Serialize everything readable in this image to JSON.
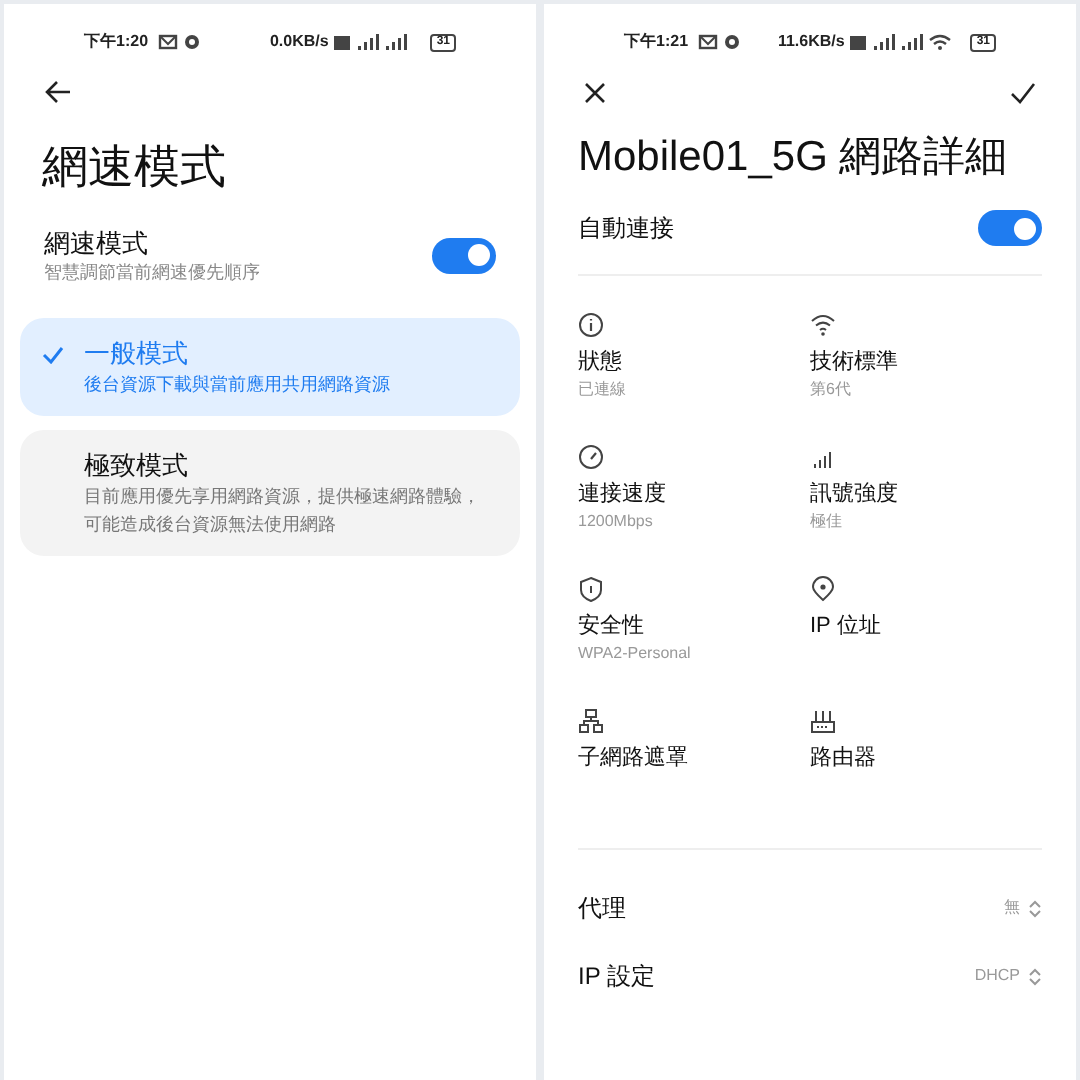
{
  "left_screen": {
    "status_bar": {
      "time": "下午1:20",
      "speed": "0.0KB/s",
      "battery": "31"
    },
    "title": "網速模式",
    "setting": {
      "label": "網速模式",
      "description": "智慧調節當前網速優先順序",
      "on": true
    },
    "modes": [
      {
        "title": "一般模式",
        "description": "後台資源下載與當前應用共用網路資源",
        "selected": true
      },
      {
        "title": "極致模式",
        "description": "目前應用優先享用網路資源，提供極速網路體驗，可能造成後台資源無法使用網路",
        "selected": false
      }
    ]
  },
  "right_screen": {
    "status_bar": {
      "time": "下午1:21",
      "speed": "11.6KB/s",
      "battery": "31"
    },
    "title": "Mobile01_5G 網路詳細",
    "auto_connect": {
      "label": "自動連接",
      "on": true
    },
    "details": [
      {
        "kind": "info",
        "label": "狀態",
        "value": "已連線"
      },
      {
        "kind": "wifi",
        "label": "技術標準",
        "value": "第6代"
      },
      {
        "kind": "speed",
        "label": "連接速度",
        "value": "1200Mbps"
      },
      {
        "kind": "signal",
        "label": "訊號強度",
        "value": "極佳"
      },
      {
        "kind": "security",
        "label": "安全性",
        "value": "WPA2-Personal"
      },
      {
        "kind": "ip",
        "label": "IP 位址"
      },
      {
        "kind": "subnet",
        "label": "子網路遮罩"
      },
      {
        "kind": "router",
        "label": "路由器"
      }
    ],
    "rows": [
      {
        "label": "代理",
        "value": "無"
      },
      {
        "label": "IP 設定",
        "value": "DHCP"
      }
    ]
  }
}
